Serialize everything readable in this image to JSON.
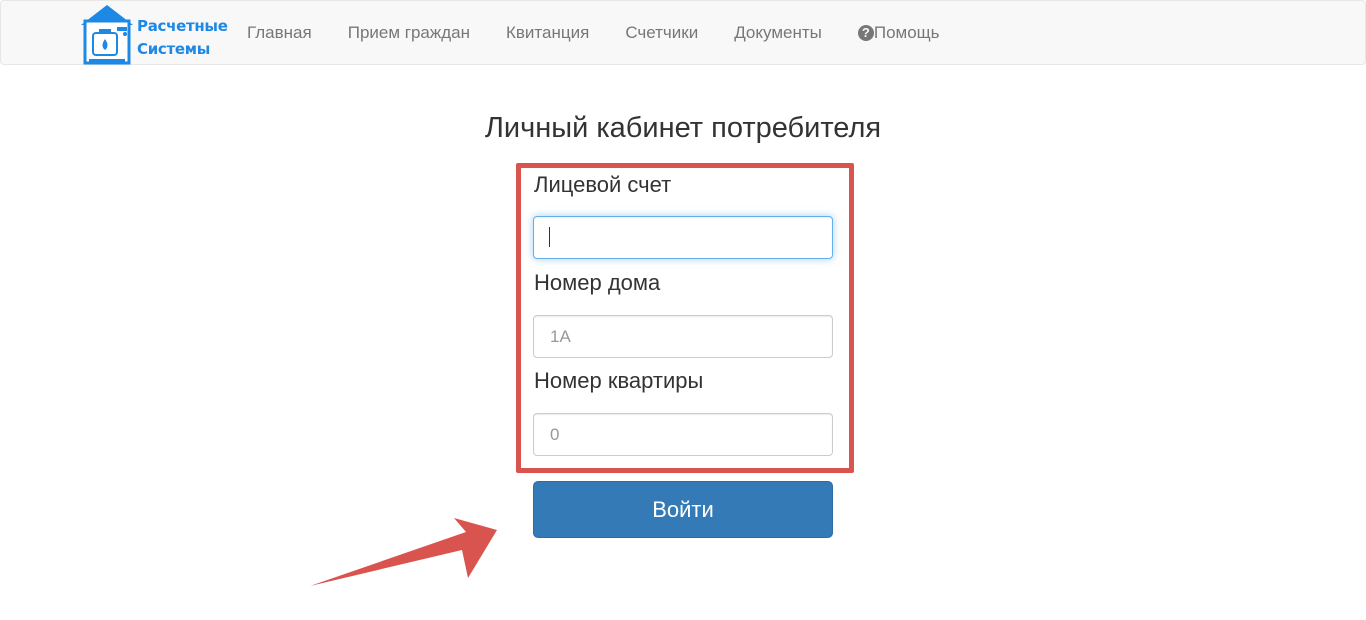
{
  "brand": {
    "line1": "Расчетные",
    "line2": "Системы",
    "color": "#1e88e5"
  },
  "nav": {
    "items": [
      {
        "label": "Главная"
      },
      {
        "label": "Прием граждан"
      },
      {
        "label": "Квитанция"
      },
      {
        "label": "Счетчики"
      },
      {
        "label": "Документы"
      },
      {
        "label": "Помощь",
        "icon": "question-circle-icon"
      }
    ]
  },
  "page": {
    "title": "Личный кабинет потребителя"
  },
  "form": {
    "account": {
      "label": "Лицевой счет",
      "value": "",
      "placeholder": ""
    },
    "house": {
      "label": "Номер дома",
      "value": "",
      "placeholder": "1А"
    },
    "apartment": {
      "label": "Номер квартиры",
      "value": "",
      "placeholder": "0"
    },
    "submit_label": "Войти"
  },
  "annotation": {
    "highlight_color": "#d9534f",
    "arrow_color": "#d9534f"
  },
  "colors": {
    "primary": "#337ab7",
    "navbar_bg": "#f8f8f8",
    "nav_text": "#777777"
  }
}
